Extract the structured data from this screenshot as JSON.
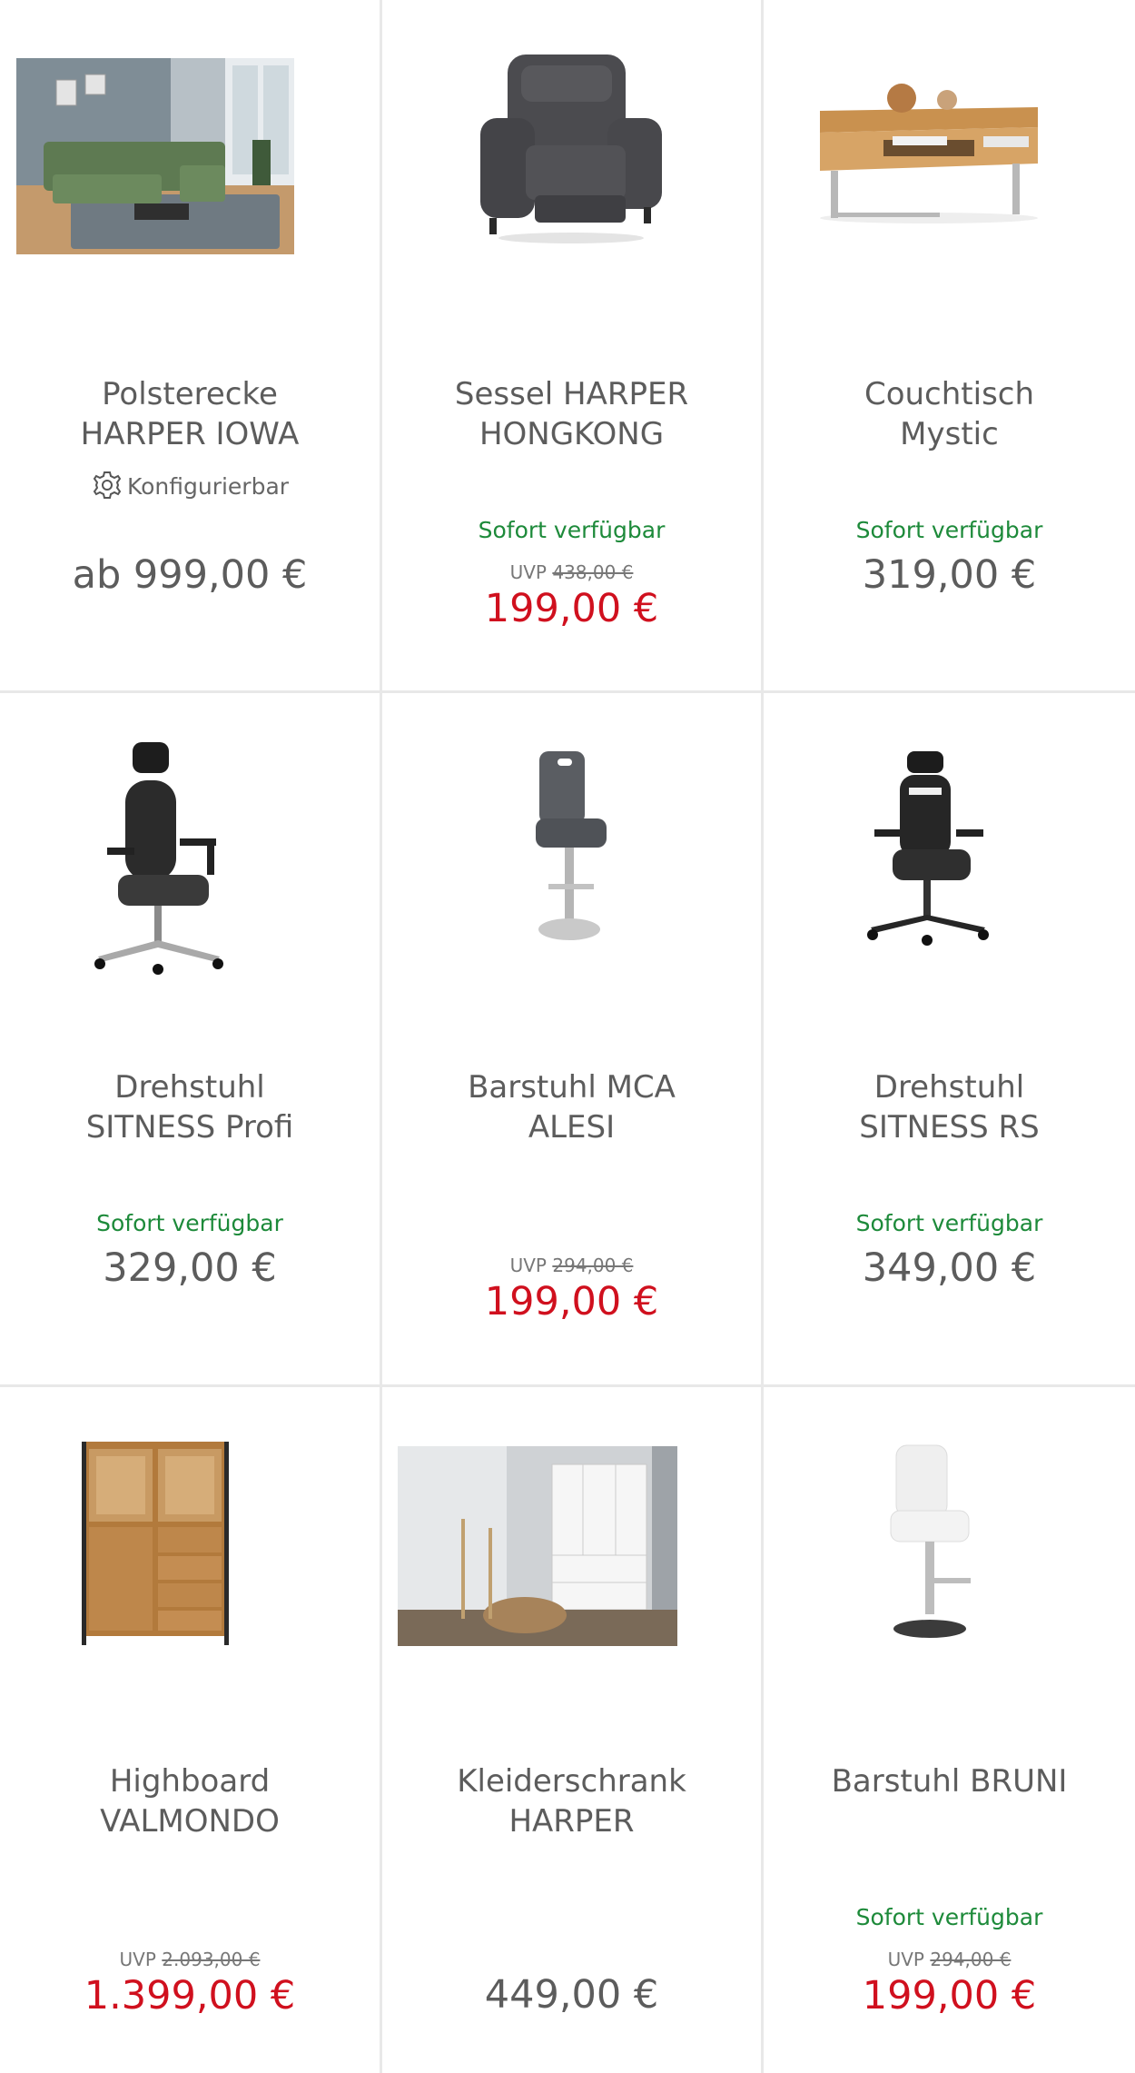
{
  "products": [
    {
      "name_line1": "Polsterecke",
      "name_line2": "HARPER IOWA",
      "config_label": "Konfigurierbar",
      "availability": "",
      "uvp_label": "",
      "uvp_value": "",
      "price": "ab 999,00 €",
      "price_type": "normal"
    },
    {
      "name_line1": "Sessel HARPER",
      "name_line2": "HONGKONG",
      "config_label": "",
      "availability": "Sofort verfügbar",
      "uvp_label": "UVP",
      "uvp_value": "438,00 €",
      "price": "199,00 €",
      "price_type": "sale"
    },
    {
      "name_line1": "Couchtisch",
      "name_line2": "Mystic",
      "config_label": "",
      "availability": "Sofort verfügbar",
      "uvp_label": "",
      "uvp_value": "",
      "price": "319,00 €",
      "price_type": "normal"
    },
    {
      "name_line1": "Drehstuhl",
      "name_line2": "SITNESS Profi",
      "config_label": "",
      "availability": "Sofort verfügbar",
      "uvp_label": "",
      "uvp_value": "",
      "price": "329,00 €",
      "price_type": "normal"
    },
    {
      "name_line1": "Barstuhl MCA",
      "name_line2": "ALESI",
      "config_label": "",
      "availability": "",
      "uvp_label": "UVP",
      "uvp_value": "294,00 €",
      "price": "199,00 €",
      "price_type": "sale"
    },
    {
      "name_line1": "Drehstuhl",
      "name_line2": "SITNESS RS",
      "config_label": "",
      "availability": "Sofort verfügbar",
      "uvp_label": "",
      "uvp_value": "",
      "price": "349,00 €",
      "price_type": "normal"
    },
    {
      "name_line1": "Highboard",
      "name_line2": "VALMONDO",
      "config_label": "",
      "availability": "",
      "uvp_label": "UVP",
      "uvp_value": "2.093,00 €",
      "price": "1.399,00 €",
      "price_type": "sale"
    },
    {
      "name_line1": "Kleiderschrank",
      "name_line2": "HARPER",
      "config_label": "",
      "availability": "",
      "uvp_label": "",
      "uvp_value": "",
      "price": "449,00 €",
      "price_type": "normal-low"
    },
    {
      "name_line1": "Barstuhl BRUNI",
      "name_line2": "",
      "config_label": "",
      "availability": "Sofort verfügbar",
      "uvp_label": "UVP",
      "uvp_value": "294,00 €",
      "price": "199,00 €",
      "price_type": "sale"
    }
  ],
  "colors": {
    "available": "#1d8a3a",
    "sale_price": "#d0101e",
    "text": "#5c5c5c",
    "divider": "#e8e8e8"
  },
  "icons": {
    "config": "gear-icon"
  }
}
